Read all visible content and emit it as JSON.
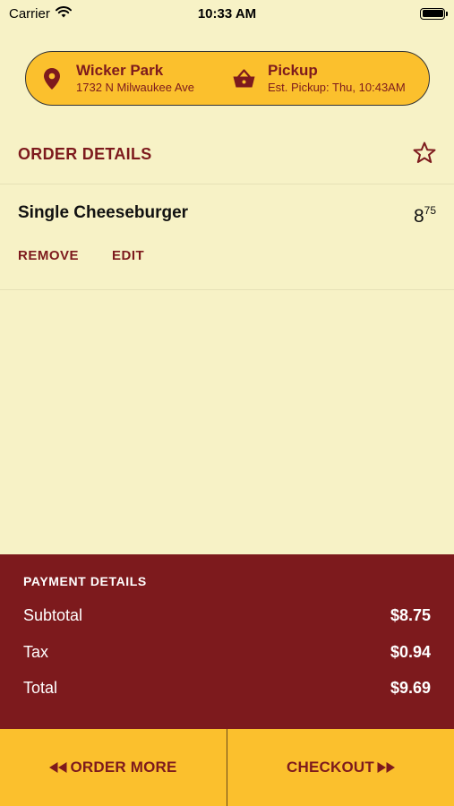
{
  "status_bar": {
    "carrier": "Carrier",
    "time": "10:33 AM"
  },
  "location": {
    "store_name": "Wicker Park",
    "store_address": "1732 N Milwaukee Ave",
    "mode": "Pickup",
    "est_pickup": "Est. Pickup: Thu, 10:43AM"
  },
  "order": {
    "title": "ORDER DETAILS",
    "items": [
      {
        "name": "Single Cheeseburger",
        "price_dollars": "8",
        "price_cents": "75",
        "remove_label": "REMOVE",
        "edit_label": "EDIT"
      }
    ]
  },
  "payment": {
    "title": "PAYMENT DETAILS",
    "subtotal_label": "Subtotal",
    "subtotal": "$8.75",
    "tax_label": "Tax",
    "tax": "$0.94",
    "total_label": "Total",
    "total": "$9.69"
  },
  "actions": {
    "order_more": "ORDER MORE",
    "checkout": "CHECKOUT"
  },
  "colors": {
    "accent": "#7d1a1d",
    "yellow": "#fbc02d",
    "background": "#f7f2c6"
  }
}
